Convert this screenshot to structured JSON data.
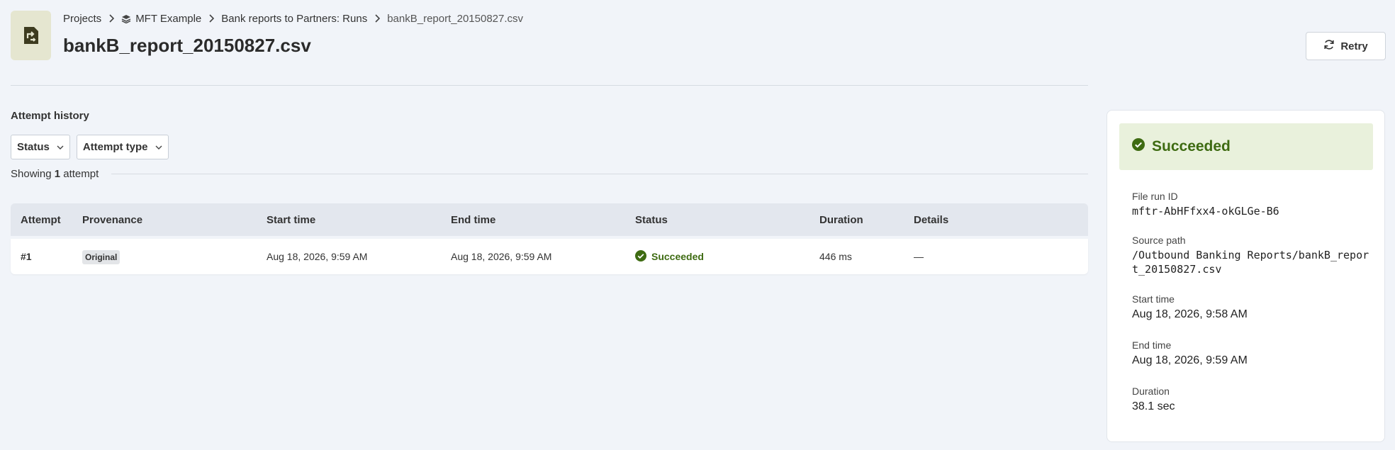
{
  "breadcrumb": {
    "projects": "Projects",
    "project": "MFT Example",
    "runs": "Bank reports to Partners: Runs",
    "current": "bankB_report_20150827.csv"
  },
  "page": {
    "title": "bankB_report_20150827.csv"
  },
  "actions": {
    "retry": "Retry"
  },
  "attempts": {
    "title": "Attempt history",
    "filters": {
      "status": "Status",
      "attempt_type": "Attempt type"
    },
    "showing_prefix": "Showing",
    "showing_count": "1",
    "showing_suffix": "attempt",
    "columns": [
      "Attempt",
      "Provenance",
      "Start time",
      "End time",
      "Status",
      "Duration",
      "Details"
    ],
    "rows": [
      {
        "attempt": "#1",
        "provenance": "Original",
        "start": "Aug 18, 2026, 9:59 AM",
        "end": "Aug 18, 2026, 9:59 AM",
        "status": "Succeeded",
        "duration": "446 ms",
        "details": "—"
      }
    ]
  },
  "summary": {
    "status": "Succeeded",
    "file_run_id_label": "File run ID",
    "file_run_id": "mftr-AbHFfxx4-okGLGe-B6",
    "source_path_label": "Source path",
    "source_path": "/Outbound Banking Reports/bankB_report_20150827.csv",
    "start_label": "Start time",
    "start": "Aug 18, 2026, 9:58 AM",
    "end_label": "End time",
    "end": "Aug 18, 2026, 9:59 AM",
    "duration_label": "Duration",
    "duration": "38.1 sec"
  },
  "colors": {
    "success": "#3e6b12",
    "success_bg": "#e9f1dc",
    "icon_bg": "#e5e6d0"
  }
}
